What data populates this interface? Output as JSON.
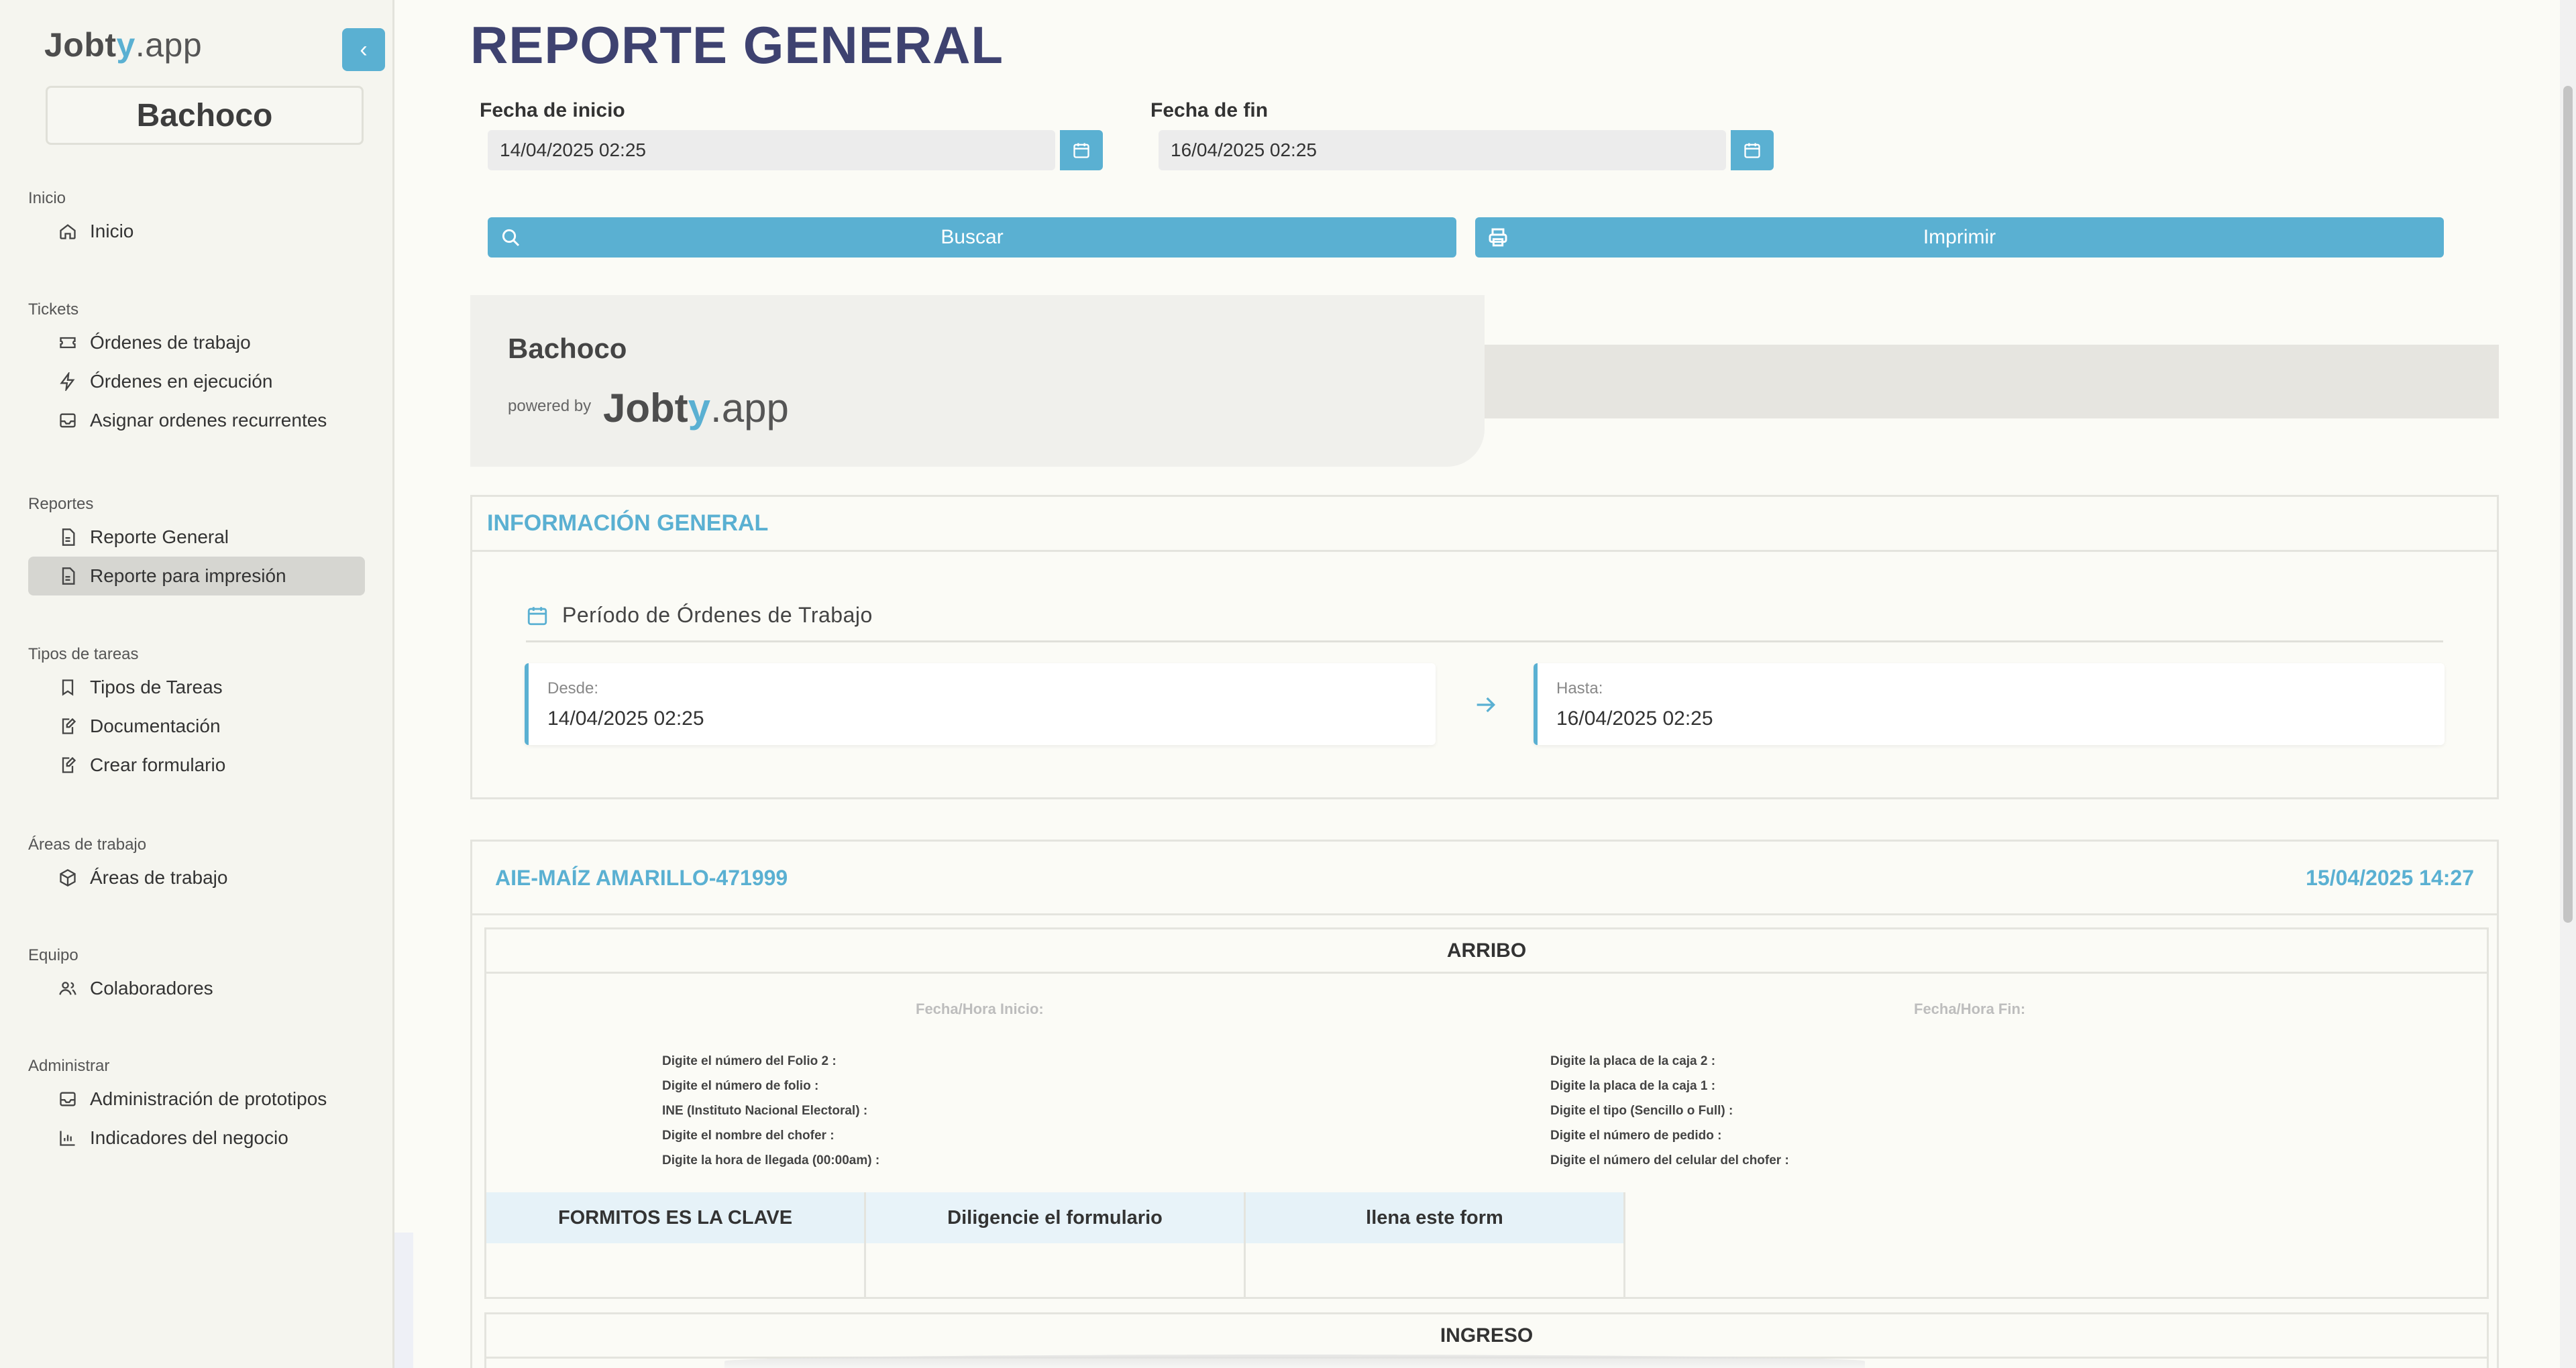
{
  "sidebar": {
    "logo": {
      "part1": "Jobt",
      "part2": "y",
      "part3": ".app"
    },
    "company": "Bachoco",
    "sections": [
      {
        "title": "Inicio",
        "items": [
          {
            "label": "Inicio",
            "icon": "home-icon"
          }
        ]
      },
      {
        "title": "Tickets",
        "items": [
          {
            "label": "Órdenes de trabajo",
            "icon": "ticket-icon"
          },
          {
            "label": "Órdenes en ejecución",
            "icon": "bolt-icon"
          },
          {
            "label": "Asignar ordenes recurrentes",
            "icon": "inbox-icon"
          }
        ]
      },
      {
        "title": "Reportes",
        "items": [
          {
            "label": "Reporte General",
            "icon": "file-icon"
          },
          {
            "label": "Reporte para impresión",
            "icon": "file-icon",
            "active": true
          }
        ]
      },
      {
        "title": "Tipos de tareas",
        "items": [
          {
            "label": "Tipos de Tareas",
            "icon": "bookmark-icon"
          },
          {
            "label": "Documentación",
            "icon": "edit-file-icon"
          },
          {
            "label": "Crear formulario",
            "icon": "edit-file-icon"
          }
        ]
      },
      {
        "title": "Áreas de trabajo",
        "items": [
          {
            "label": "Áreas de trabajo",
            "icon": "box-icon"
          }
        ]
      },
      {
        "title": "Equipo",
        "items": [
          {
            "label": "Colaboradores",
            "icon": "users-icon"
          }
        ]
      },
      {
        "title": "Administrar",
        "items": [
          {
            "label": "Administración de prototipos",
            "icon": "inbox-icon"
          },
          {
            "label": "Indicadores del negocio",
            "icon": "bar-chart-icon"
          }
        ]
      }
    ]
  },
  "main": {
    "title": "REPORTE GENERAL",
    "start_label": "Fecha de inicio",
    "start_value": "14/04/2025 02:25",
    "end_label": "Fecha de fin",
    "end_value": "16/04/2025 02:25",
    "search_label": "Buscar",
    "print_label": "Imprimir"
  },
  "brand": {
    "name": "Bachoco",
    "powered_by": "powered by"
  },
  "info": {
    "heading": "INFORMACIÓN GENERAL",
    "period_title": "Período de Órdenes de Trabajo",
    "from_caption": "Desde:",
    "from_value": "14/04/2025 02:25",
    "to_caption": "Hasta:",
    "to_value": "16/04/2025 02:25"
  },
  "work_order": {
    "id": "AIE-MAÍZ AMARILLO-471999",
    "date": "15/04/2025 14:27",
    "section1": {
      "title": "ARRIBO",
      "start_label": "Fecha/Hora Inicio:",
      "end_label": "Fecha/Hora Fin:",
      "left_questions": [
        "Digite el número del Folio 2 :",
        "Digite el número de folio :",
        "INE (Instituto Nacional Electoral) :",
        "Digite el nombre del chofer :",
        "Digite la hora de llegada (00:00am) :"
      ],
      "right_questions": [
        "Digite la placa de la caja 2 :",
        "Digite la placa de la caja 1 :",
        "Digite el tipo (Sencillo o Full) :",
        "Digite el número de pedido :",
        "Digite el número del celular del chofer :"
      ],
      "form_headers": [
        "FORMITOS ES LA CLAVE",
        "Diligencie el formulario",
        "llena este form"
      ]
    },
    "section2": {
      "title": "INGRESO"
    }
  },
  "colors": {
    "accent": "#5ab0d2",
    "title": "#3e4270",
    "active_bg": "#d6d6d1"
  }
}
